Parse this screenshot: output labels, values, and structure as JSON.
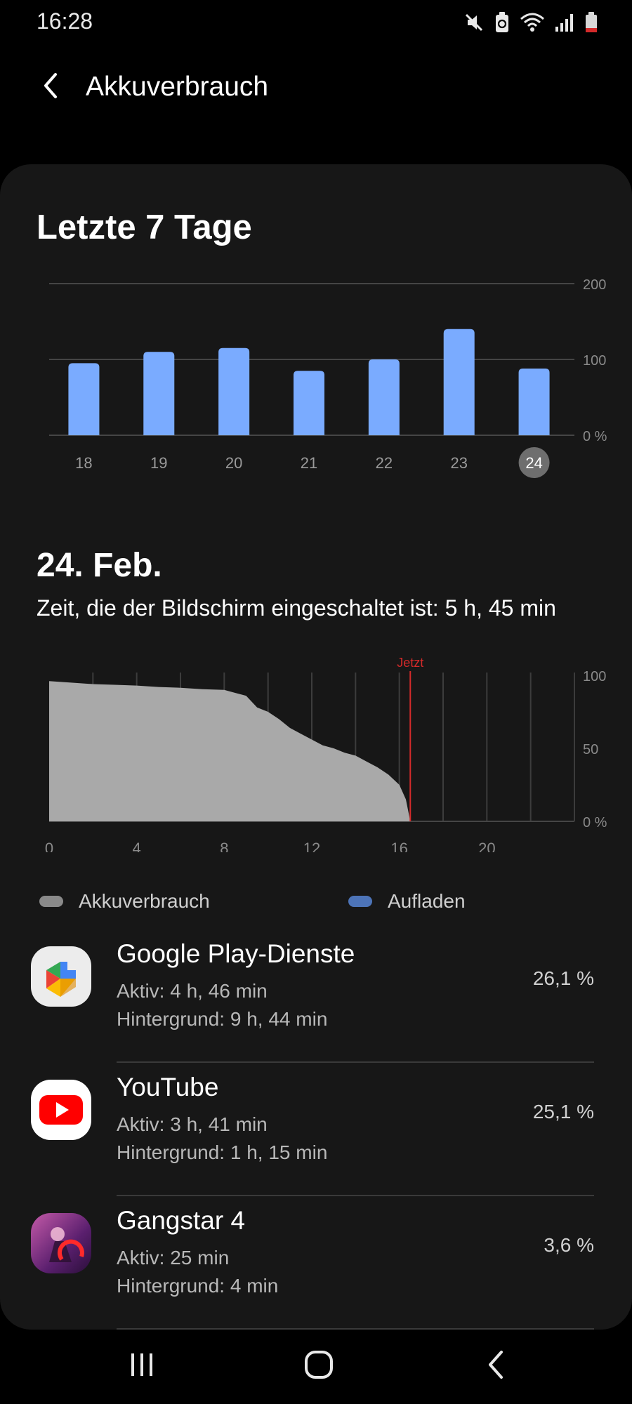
{
  "status_bar": {
    "time": "16:28",
    "icons": [
      "mute-icon",
      "battery-saver-icon",
      "wifi-icon",
      "signal-icon",
      "battery-low-icon"
    ]
  },
  "header": {
    "title": "Akkuverbrauch",
    "back_icon": "back-arrow-icon"
  },
  "weekly": {
    "title": "Letzte 7 Tage",
    "selected_day": "24"
  },
  "daily": {
    "title": "24. Feb.",
    "screen_time": "Zeit, die der Bildschirm eingeschaltet ist: 5 h, 45 min",
    "now_label": "Jetzt",
    "now_hour": 16.5
  },
  "legend": {
    "drain_label": "Akkuverbrauch",
    "charge_label": "Aufladen"
  },
  "colors": {
    "bar": "#7aabff",
    "drain": "#a9a9a9",
    "now_line": "#d42a2a",
    "legend_drain": "#8a8a8a",
    "legend_charge": "#4d74b8"
  },
  "apps": [
    {
      "name": "Google Play-Dienste",
      "active": "Aktiv: 4 h, 46 min",
      "background": "Hintergrund: 9 h, 44 min",
      "percent": "26,1 %",
      "icon": "google-play-services-icon"
    },
    {
      "name": "YouTube",
      "active": "Aktiv: 3 h, 41 min",
      "background": "Hintergrund: 1 h, 15 min",
      "percent": "25,1 %",
      "icon": "youtube-icon"
    },
    {
      "name": "Gangstar 4",
      "active": "Aktiv: 25 min",
      "background": "Hintergrund: 4 min",
      "percent": "3,6 %",
      "icon": "gangstar-icon"
    }
  ],
  "nav_bar": {
    "buttons": [
      "recents-icon",
      "home-icon",
      "back-icon"
    ]
  },
  "chart_data": [
    {
      "type": "bar",
      "categories": [
        "18",
        "19",
        "20",
        "21",
        "22",
        "23",
        "24"
      ],
      "values": [
        95,
        110,
        115,
        85,
        100,
        140,
        88
      ],
      "ylim": [
        0,
        200
      ],
      "yticks": [
        "0 %",
        "100",
        "200"
      ],
      "ytick_values": [
        0,
        100,
        200
      ],
      "grid": true
    },
    {
      "type": "area",
      "x": [
        0,
        1,
        2,
        3,
        4,
        5,
        6,
        7,
        8,
        8.5,
        9,
        9.5,
        10,
        10.5,
        11,
        11.5,
        12,
        12.5,
        13,
        13.5,
        14,
        14.5,
        15,
        15.5,
        16,
        16.3,
        16.5
      ],
      "y": [
        96,
        95,
        94,
        93.5,
        93,
        92,
        91.5,
        90.5,
        90,
        88,
        86,
        78,
        75,
        70,
        64,
        60,
        56,
        52,
        50,
        47,
        45,
        41,
        37,
        32,
        25,
        15,
        0
      ],
      "xlim": [
        0,
        24
      ],
      "xticks": [
        "0",
        "4",
        "8",
        "12",
        "16",
        "20"
      ],
      "xtick_values": [
        0,
        4,
        8,
        12,
        16,
        20
      ],
      "ylim": [
        0,
        100
      ],
      "yticks": [
        "0 %",
        "50",
        "100"
      ],
      "ytick_values": [
        0,
        50,
        100
      ],
      "grid": true
    }
  ]
}
